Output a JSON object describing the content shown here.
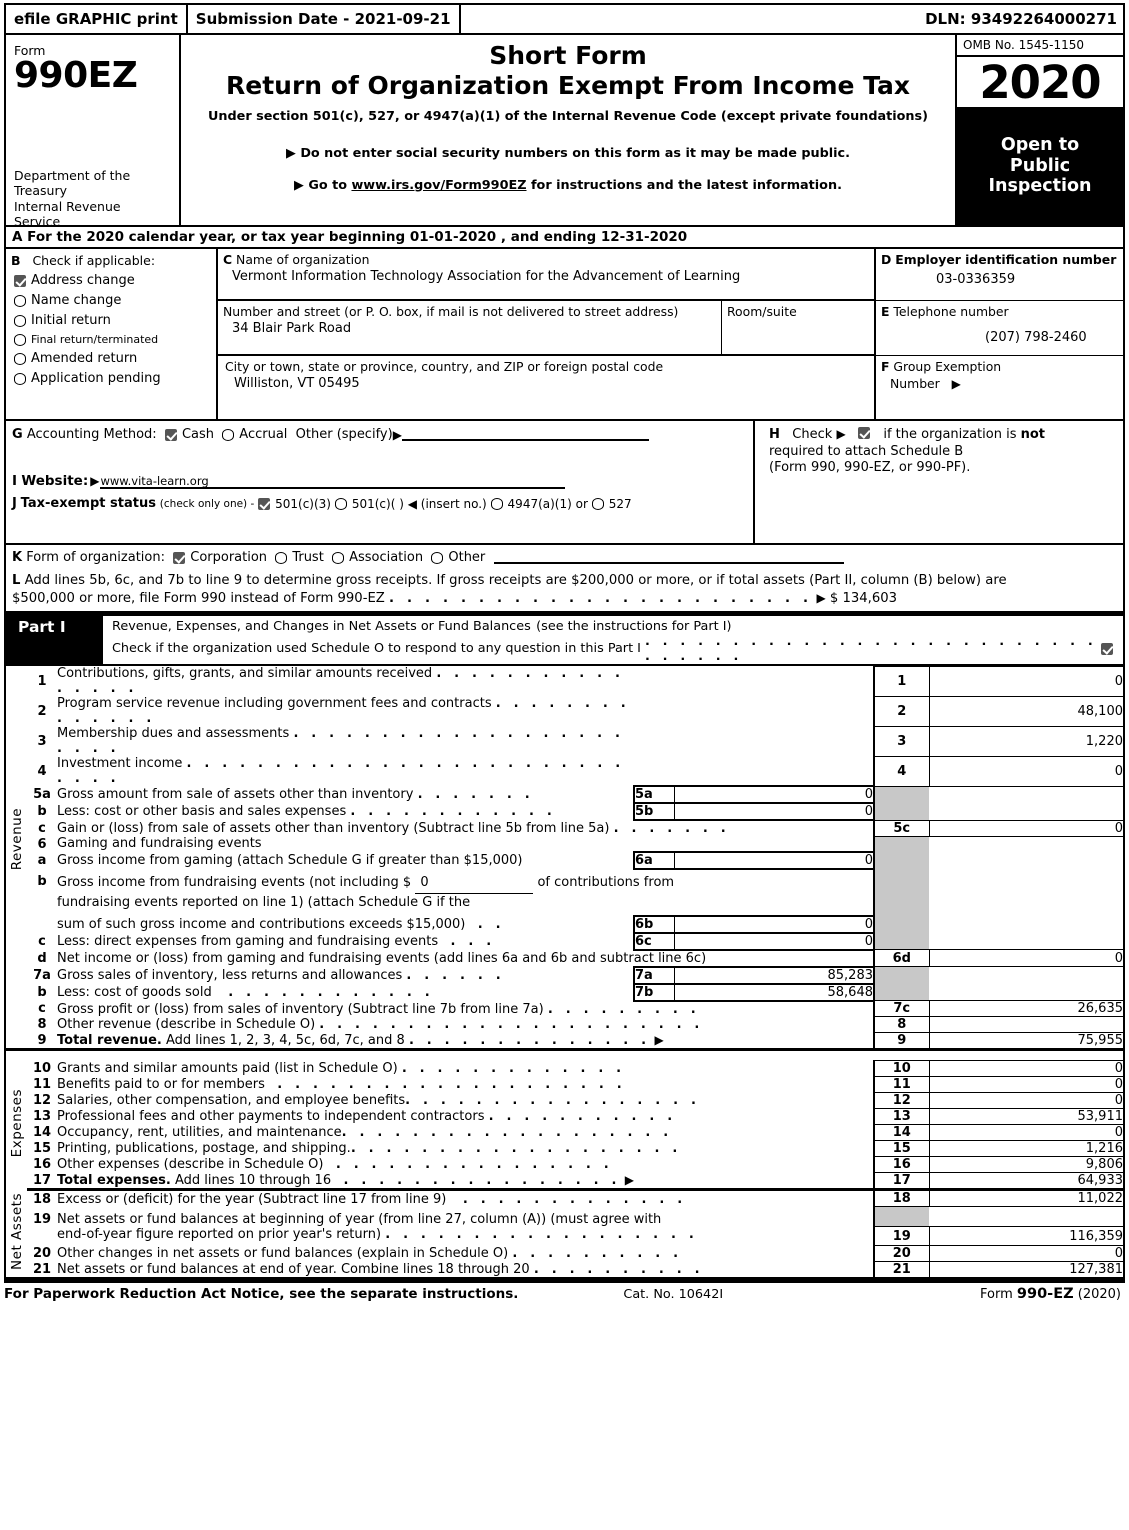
{
  "efile": {
    "graphic_print": "efile GRAPHIC print",
    "submission_date": "Submission Date - 2021-09-21",
    "dln": "DLN: 93492264000271"
  },
  "masthead": {
    "form_label": "Form",
    "form_number": "990EZ",
    "department": "Department of the Treasury Internal Revenue Service",
    "title_line1": "Short Form",
    "title_line2": "Return of Organization Exempt From Income Tax",
    "subtitle": "Under section 501(c), 527, or 4947(a)(1) of the Internal Revenue Code (except private foundations)",
    "bullet1": "Do not enter social security numbers on this form as it may be made public.",
    "bullet2_pre": "Go to ",
    "bullet2_link": "www.irs.gov/Form990EZ",
    "bullet2_post": " for instructions and the latest information.",
    "omb": "OMB No. 1545-1150",
    "year": "2020",
    "open_to": "Open to",
    "public": "Public",
    "inspection": "Inspection"
  },
  "lineA": {
    "letter": "A",
    "text": "For the 2020 calendar year, or tax year beginning 01-01-2020 , and ending 12-31-2020"
  },
  "sectionB": {
    "letter": "B",
    "header": "Check if applicable:",
    "items": [
      {
        "label": "Address change",
        "checked": true
      },
      {
        "label": "Name change",
        "checked": false
      },
      {
        "label": "Initial return",
        "checked": false
      },
      {
        "label": "Final return/terminated",
        "checked": false
      },
      {
        "label": "Amended return",
        "checked": false
      },
      {
        "label": "Application pending",
        "checked": false
      }
    ]
  },
  "sectionC": {
    "letter": "C",
    "name_label": "Name of organization",
    "name_value": "Vermont Information Technology Association for the Advancement of Learning",
    "street_label": "Number and street (or P. O. box, if mail is not delivered to street address)",
    "street_value": "34 Blair Park Road",
    "room_label": "Room/suite",
    "room_value": "",
    "city_label": "City or town, state or province, country, and ZIP or foreign postal code",
    "city_value": "Williston, VT  05495"
  },
  "sectionD": {
    "letter": "D",
    "ein_label": "Employer identification number",
    "ein_value": "03-0336359",
    "tel_letter": "E",
    "tel_label": "Telephone number",
    "tel_value": "(207) 798-2460",
    "grp_letter": "F",
    "grp_label_1": "Group Exemption",
    "grp_label_2": "Number"
  },
  "sectionG": {
    "letter": "G",
    "label": "Accounting Method:",
    "cash": "Cash",
    "cash_checked": true,
    "accrual": "Accrual",
    "accrual_checked": false,
    "other": "Other (specify)"
  },
  "sectionH": {
    "letter": "H",
    "check_word": "Check",
    "checked": true,
    "line1_a": "if the organization is ",
    "line1_b": "not",
    "line2": "required to attach Schedule B",
    "line3": "(Form 990, 990-EZ, or 990-PF)."
  },
  "sectionI": {
    "letter": "I",
    "label": "Website:",
    "value": "www.vita-learn.org"
  },
  "sectionJ": {
    "letter": "J",
    "label": "Tax-exempt status",
    "note": "(check only one) -",
    "opt1": "501(c)(3)",
    "opt1_checked": true,
    "opt2": "501(c)(    )",
    "opt2_checked": false,
    "insert": "(insert no.)",
    "opt3": "4947(a)(1)",
    "opt3_checked": false,
    "or_text": "or",
    "opt4": "527",
    "opt4_checked": false
  },
  "sectionK": {
    "letter": "K",
    "label": "Form of organization:",
    "options": [
      {
        "label": "Corporation",
        "checked": true
      },
      {
        "label": "Trust",
        "checked": false
      },
      {
        "label": "Association",
        "checked": false
      },
      {
        "label": "Other",
        "checked": false
      }
    ]
  },
  "sectionL": {
    "letter": "L",
    "text_1": "Add lines 5b, 6c, and 7b to line 9 to determine gross receipts. If gross receipts are $200,000 or more, or if total assets (Part II, column (B) below) are",
    "text_2": "$500,000 or more, file Form 990 instead of Form 990-EZ",
    "gross_receipts": "$ 134,603"
  },
  "partI": {
    "tag": "Part I",
    "title": "Revenue, Expenses, and Changes in Net Assets or Fund Balances",
    "title_note": "(see the instructions for Part I)",
    "schedule_o_text": "Check if the organization used Schedule O to respond to any question in this Part I",
    "schedule_o_checked": true
  },
  "vlabels": {
    "revenue": "Revenue",
    "expenses": "Expenses",
    "net_assets": "Net Assets"
  },
  "rows": {
    "r1": {
      "num": "1",
      "desc": "Contributions, gifts, grants, and similar amounts received",
      "main_num": "1",
      "value": "0"
    },
    "r2": {
      "num": "2",
      "desc": "Program service revenue including government fees and contracts",
      "main_num": "2",
      "value": "48,100"
    },
    "r3": {
      "num": "3",
      "desc": "Membership dues and assessments",
      "main_num": "3",
      "value": "1,220"
    },
    "r4": {
      "num": "4",
      "desc": "Investment income",
      "main_num": "4",
      "value": "0"
    },
    "r5a": {
      "num": "5a",
      "desc": "Gross amount from sale of assets other than inventory",
      "sub_num": "5a",
      "sub_value": "0"
    },
    "r5b": {
      "num": "b",
      "desc": "Less: cost or other basis and sales expenses",
      "sub_num": "5b",
      "sub_value": "0"
    },
    "r5c": {
      "num": "c",
      "desc": "Gain or (loss) from sale of assets other than inventory (Subtract line 5b from line 5a)",
      "main_num": "5c",
      "value": "0"
    },
    "r6": {
      "num": "6",
      "desc": "Gaming and fundraising events"
    },
    "r6a": {
      "num": "a",
      "desc": "Gross income from gaming (attach Schedule G if greater than $15,000)",
      "sub_num": "6a",
      "sub_value": "0"
    },
    "r6b": {
      "num": "b",
      "desc_1": "Gross income from fundraising events (not including $",
      "inline_value": "0",
      "desc_2": "of contributions from",
      "desc_3": "fundraising events reported on line 1) (attach Schedule G if the",
      "desc_4": "sum of such gross income and contributions exceeds $15,000)",
      "sub_num": "6b",
      "sub_value": "0"
    },
    "r6c": {
      "num": "c",
      "desc": "Less: direct expenses from gaming and fundraising events",
      "sub_num": "6c",
      "sub_value": "0"
    },
    "r6d": {
      "num": "d",
      "desc": "Net income or (loss) from gaming and fundraising events (add lines 6a and 6b and subtract line 6c)",
      "main_num": "6d",
      "value": "0"
    },
    "r7a": {
      "num": "7a",
      "desc": "Gross sales of inventory, less returns and allowances",
      "sub_num": "7a",
      "sub_value": "85,283"
    },
    "r7b": {
      "num": "b",
      "desc": "Less: cost of goods sold",
      "sub_num": "7b",
      "sub_value": "58,648"
    },
    "r7c": {
      "num": "c",
      "desc": "Gross profit or (loss) from sales of inventory (Subtract line 7b from line 7a)",
      "main_num": "7c",
      "value": "26,635"
    },
    "r8": {
      "num": "8",
      "desc": "Other revenue (describe in Schedule O)",
      "main_num": "8",
      "value": ""
    },
    "r9": {
      "num": "9",
      "desc_bold": "Total revenue.",
      "desc": " Add lines 1, 2, 3, 4, 5c, 6d, 7c, and 8",
      "main_num": "9",
      "value": "75,955"
    },
    "r10": {
      "num": "10",
      "desc": "Grants and similar amounts paid (list in Schedule O)",
      "main_num": "10",
      "value": "0"
    },
    "r11": {
      "num": "11",
      "desc": "Benefits paid to or for members",
      "main_num": "11",
      "value": "0"
    },
    "r12": {
      "num": "12",
      "desc": "Salaries, other compensation, and employee benefits",
      "main_num": "12",
      "value": "0"
    },
    "r13": {
      "num": "13",
      "desc": "Professional fees and other payments to independent contractors",
      "main_num": "13",
      "value": "53,911"
    },
    "r14": {
      "num": "14",
      "desc": "Occupancy, rent, utilities, and maintenance",
      "main_num": "14",
      "value": "0"
    },
    "r15": {
      "num": "15",
      "desc": "Printing, publications, postage, and shipping.",
      "main_num": "15",
      "value": "1,216"
    },
    "r16": {
      "num": "16",
      "desc": "Other expenses (describe in Schedule O)",
      "main_num": "16",
      "value": "9,806"
    },
    "r17": {
      "num": "17",
      "desc_bold": "Total expenses.",
      "desc": " Add lines 10 through 16",
      "main_num": "17",
      "value": "64,933"
    },
    "r18": {
      "num": "18",
      "desc": "Excess or (deficit) for the year (Subtract line 17 from line 9)",
      "main_num": "18",
      "value": "11,022"
    },
    "r19": {
      "num": "19",
      "desc_1": "Net assets or fund balances at beginning of year (from line 27, column (A)) (must agree with",
      "desc_2": "end-of-year figure reported on prior year's return)",
      "main_num": "19",
      "value": "116,359"
    },
    "r20": {
      "num": "20",
      "desc": "Other changes in net assets or fund balances (explain in Schedule O)",
      "main_num": "20",
      "value": "0"
    },
    "r21": {
      "num": "21",
      "desc": "Net assets or fund balances at end of year. Combine lines 18 through 20",
      "main_num": "21",
      "value": "127,381"
    }
  },
  "footer": {
    "notice": "For Paperwork Reduction Act Notice, see the separate instructions.",
    "cat": "Cat. No. 10642I",
    "form_pre": "Form ",
    "form_num": "990-EZ",
    "form_year": " (2020)"
  }
}
